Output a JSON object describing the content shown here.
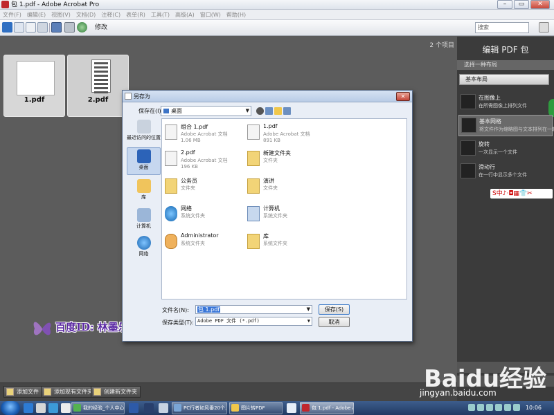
{
  "window": {
    "title": "包 1.pdf - Adobe Acrobat Pro",
    "min": "–",
    "max": "▭",
    "close": "✕"
  },
  "menu": [
    "文件(F)",
    "编辑(E)",
    "视图(V)",
    "文档(D)",
    "注释(C)",
    "表单(R)",
    "工具(T)",
    "高级(A)",
    "窗口(W)",
    "帮助(H)"
  ],
  "toolbar": {
    "edit_label": "修改",
    "search_placeholder": "搜索"
  },
  "workspace": {
    "items_count": "2 个项目",
    "thumbnails": [
      {
        "label": "1.pdf"
      },
      {
        "label": "2.pdf"
      }
    ]
  },
  "right_panel": {
    "title": "编辑 PDF 包",
    "subtitle": "选择一种布局",
    "selected_layout": "基本布局",
    "layouts": [
      {
        "name": "在图像上",
        "desc": "在所需图像上排列文件"
      },
      {
        "name": "基本网格",
        "desc": "将文件作为缩略图与文本排列在一起"
      },
      {
        "name": "旋转",
        "desc": "一次显示一个文件"
      },
      {
        "name": "滑动行",
        "desc": "在一行中显示多个文件"
      }
    ],
    "ime_bar": "S中♪·◘▦👕✂"
  },
  "bottom_bar": {
    "add_file": "添加文件",
    "add_existing_folder": "添加现有文件夹",
    "create_new_folder": "创建新文件夹"
  },
  "dialog": {
    "title": "另存为",
    "save_in_label": "保存在(I):",
    "save_in_value": "桌面",
    "places": [
      "最近访问的位置",
      "桌面",
      "库",
      "计算机",
      "网络"
    ],
    "files": [
      {
        "name": "组合 1.pdf",
        "type": "Adobe Acrobat 文档",
        "size": "1.06 MB"
      },
      {
        "name": "1.pdf",
        "type": "Adobe Acrobat 文档",
        "size": "891 KB"
      },
      {
        "name": "2.pdf",
        "type": "Adobe Acrobat 文档",
        "size": "196 KB"
      },
      {
        "name": "新建文件夹",
        "type": "文件夹",
        "size": ""
      },
      {
        "name": "公务员",
        "type": "文件夹",
        "size": ""
      },
      {
        "name": "演讲",
        "type": "文件夹",
        "size": ""
      },
      {
        "name": "网络",
        "type": "系统文件夹",
        "size": ""
      },
      {
        "name": "计算机",
        "type": "系统文件夹",
        "size": ""
      },
      {
        "name": "Administrator",
        "type": "系统文件夹",
        "size": ""
      },
      {
        "name": "库",
        "type": "系统文件夹",
        "size": ""
      }
    ],
    "file_name_label": "文件名(N):",
    "file_name_value": "包 1.pdf",
    "file_type_label": "保存类型(T):",
    "file_type_value": "Adobe PDF 文件 (*.pdf)",
    "save_button": "保存(S)",
    "cancel_button": "取消"
  },
  "taskbar": {
    "tasks": [
      "我的经验_个人中心...",
      "PC行者如风番20个...",
      "图片转PDF",
      "包 1.pdf - Adobe A..."
    ],
    "clock": "10:06"
  },
  "watermark": {
    "author": "百度ID: 林墨乐园",
    "baidu_logo": "Baidu经验",
    "baidu_url": "jingyan.baidu.com"
  },
  "colors": {
    "workspace_bg": "#5c5c5c",
    "panel_bg": "#3b3b3b",
    "dialog_bg": "#e9eef6",
    "selection": "#3875d7",
    "taskbar": "#2b4a7a"
  }
}
